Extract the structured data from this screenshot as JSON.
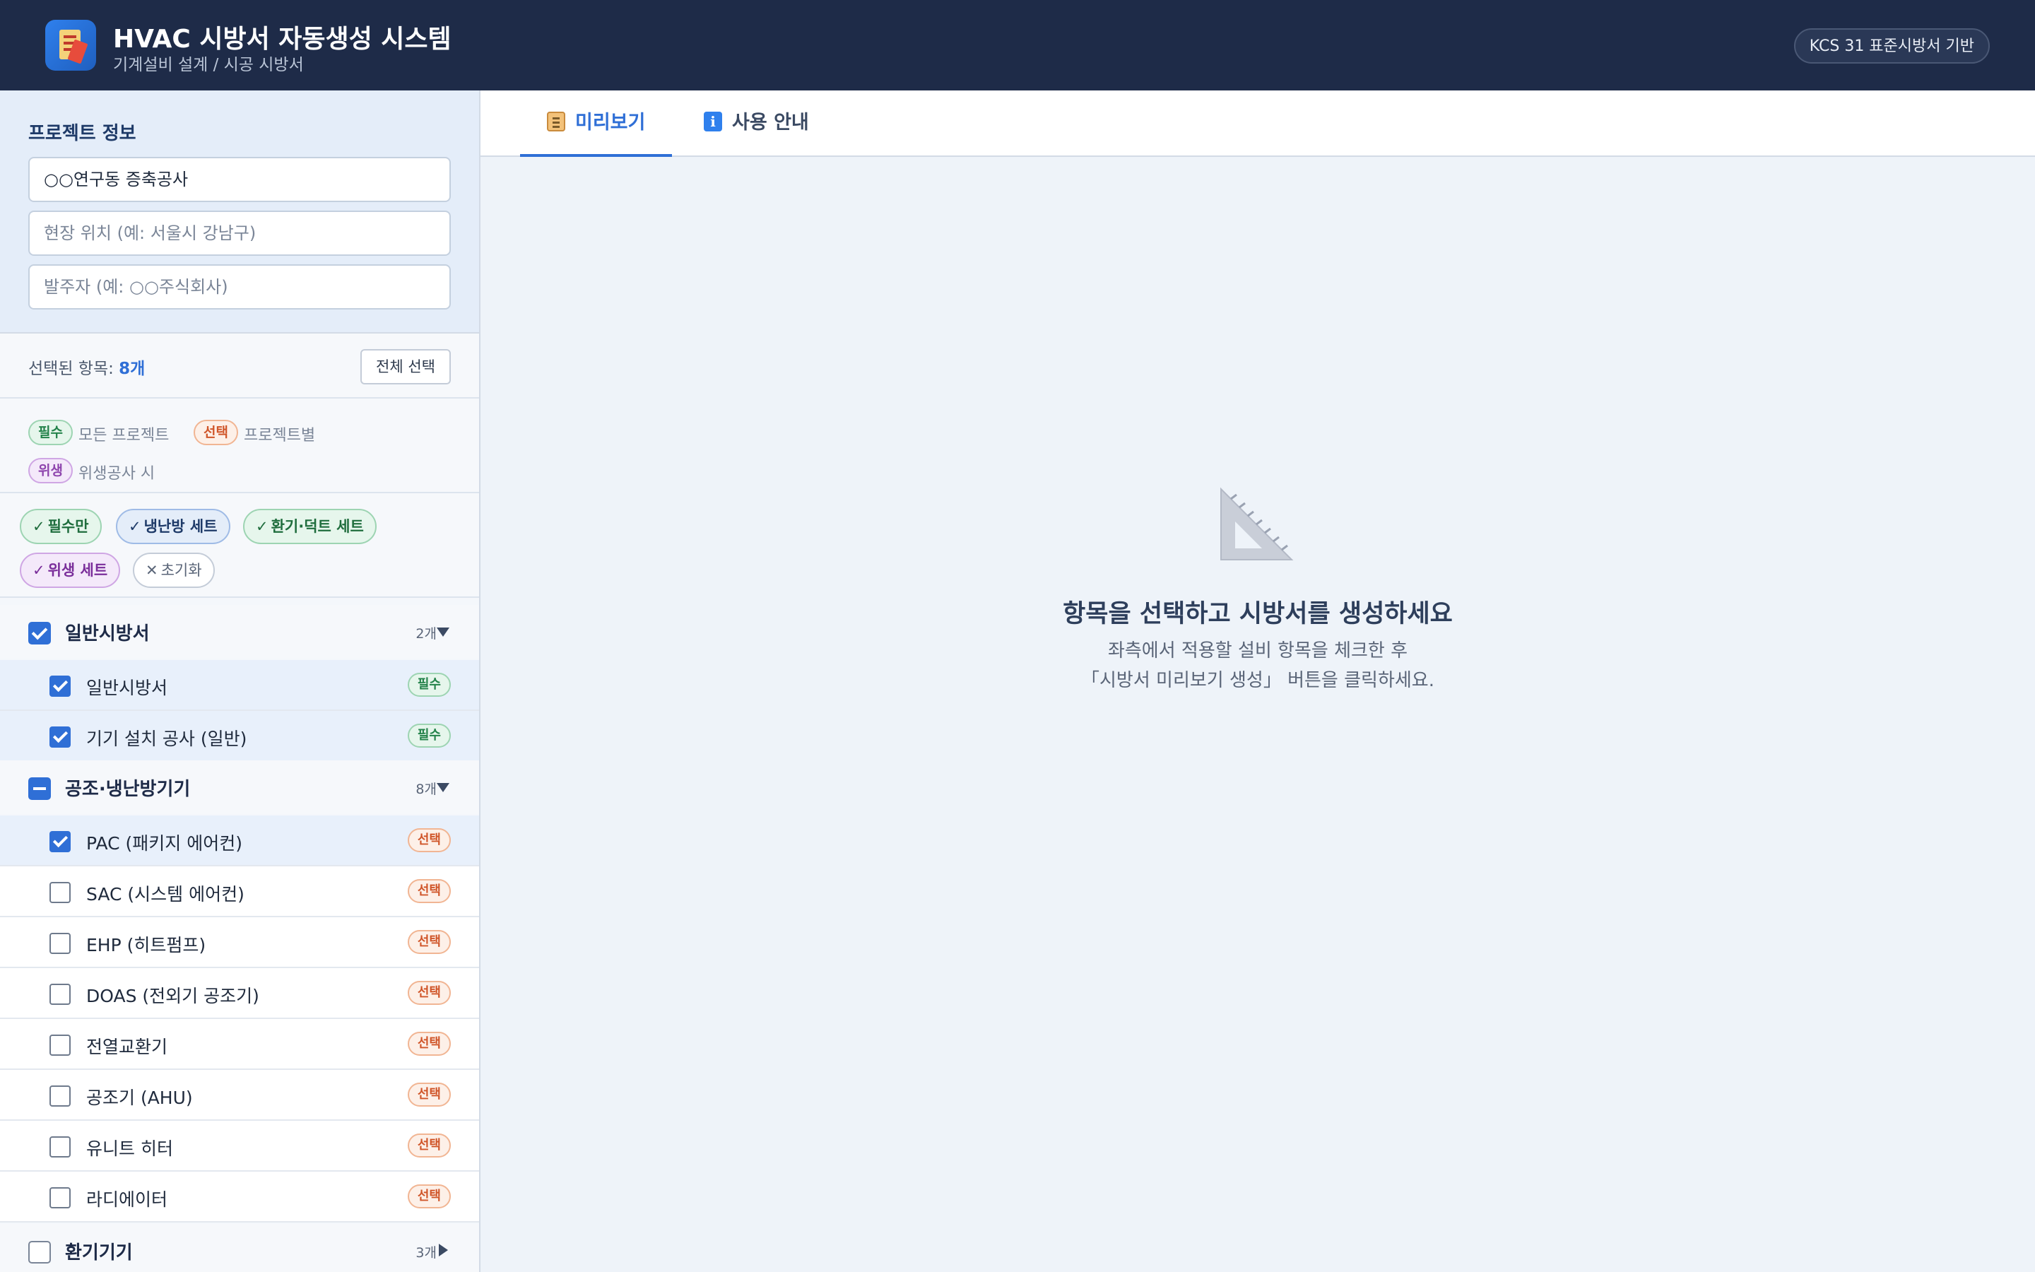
{
  "header": {
    "title": "HVAC 시방서 자동생성 시스템",
    "subtitle": "기계설비 설계 / 시공 시방서",
    "badge": "KCS 31 표준시방서 기반"
  },
  "project": {
    "section_title": "프로젝트 정보",
    "name_value": "○○연구동 증축공사",
    "location_placeholder": "현장 위치 (예: 서울시 강남구)",
    "client_placeholder": "발주자 (예: ○○주식회사)"
  },
  "selection": {
    "label": "선택된 항목: ",
    "count": "8개",
    "select_all": "전체 선택"
  },
  "legend": {
    "required_tag": "필수",
    "required_desc": "모든 프로젝트",
    "optional_tag": "선택",
    "optional_desc": "프로젝트별",
    "hygiene_tag": "위생",
    "hygiene_desc": "위생공사 시"
  },
  "presets": {
    "check": "✓",
    "required_only": "필수만",
    "cooling_heating": "냉난방 세트",
    "ventilation_duct": "환기·덕트 세트",
    "hygiene": "위생 세트",
    "reset_icon": "✕",
    "reset": "초기화"
  },
  "tree": {
    "groups": [
      {
        "name": "일반시방서",
        "count": "2개",
        "state": "checked",
        "expanded": true,
        "items": [
          {
            "label": "일반시방서",
            "tag": "필수",
            "checked": true
          },
          {
            "label": "기기 설치 공사 (일반)",
            "tag": "필수",
            "checked": true
          }
        ]
      },
      {
        "name": "공조·냉난방기기",
        "count": "8개",
        "state": "indeterminate",
        "expanded": true,
        "items": [
          {
            "label": "PAC (패키지 에어컨)",
            "tag": "선택",
            "checked": true
          },
          {
            "label": "SAC (시스템 에어컨)",
            "tag": "선택",
            "checked": false
          },
          {
            "label": "EHP (히트펌프)",
            "tag": "선택",
            "checked": false
          },
          {
            "label": "DOAS (전외기 공조기)",
            "tag": "선택",
            "checked": false
          },
          {
            "label": "전열교환기",
            "tag": "선택",
            "checked": false
          },
          {
            "label": "공조기 (AHU)",
            "tag": "선택",
            "checked": false
          },
          {
            "label": "유니트 히터",
            "tag": "선택",
            "checked": false
          },
          {
            "label": "라디에이터",
            "tag": "선택",
            "checked": false
          }
        ]
      },
      {
        "name": "환기기기",
        "count": "3개",
        "state": "unchecked",
        "expanded": false,
        "items": []
      }
    ]
  },
  "tabs": [
    {
      "label": "미리보기",
      "icon": "clipboard-icon",
      "active": true
    },
    {
      "label": "사용 안내",
      "icon": "info-icon",
      "active": false
    }
  ],
  "empty_state": {
    "icon": "triangle-ruler-icon",
    "title": "항목을 선택하고 시방서를 생성하세요",
    "line1": "좌측에서 적용할 설비 항목을 체크한 후",
    "line2": "「시방서 미리보기 생성」 버튼을 클릭하세요."
  },
  "colors": {
    "header_bg": "#1e2b48",
    "accent": "#2f6fd6",
    "required": "#23824a",
    "optional": "#d0562a",
    "hygiene": "#8e44ad"
  }
}
